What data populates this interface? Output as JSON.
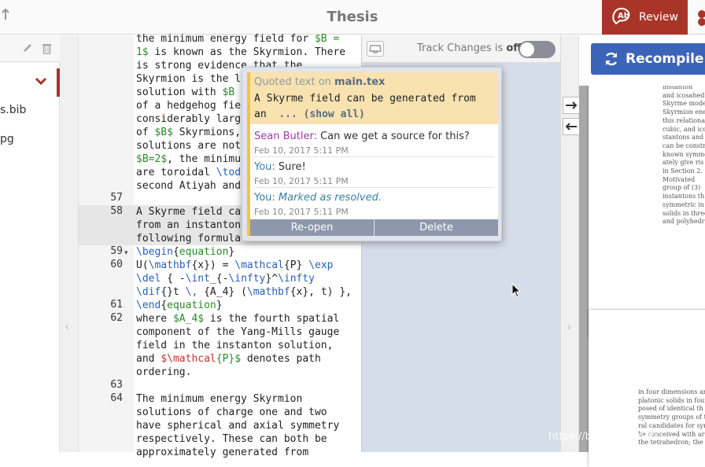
{
  "header": {
    "title": "Thesis",
    "review_label": "Review",
    "accent": "#a93529"
  },
  "filetree": {
    "files": [
      {
        "label": "s.bib"
      },
      {
        "label": "pg"
      }
    ]
  },
  "editor": {
    "line_numbers": [
      "57",
      "58",
      "59",
      "60",
      "61",
      "62",
      "63",
      "64"
    ],
    "lines": {
      "l1": "the minimum energy field for ",
      "l1a": "$B =",
      "l2a": "1$",
      "l2": " is known as the Skyrmion. There",
      "l3": "is strong evidence that the",
      "l4": "Skyrmion is the l",
      "l5": "solution with ",
      "l5a": "$B",
      "l6": "of a hedgehog fie",
      "l7": "considerably larg",
      "l8": "of ",
      "l8a": "$B$",
      "l8b": " Skyrmions,",
      "l9": "solutions are not",
      "l10a": "$B=2$",
      "l10": ", the minimu",
      "l11": "are toroidal ",
      "l11a": "\\tod",
      "l12": "second Atiyah and",
      "l58a": "A Skyrme field ca",
      "l58b": "from an instanton",
      "l58c": "following formula",
      "l59a": "\\begin",
      "l59b": "{",
      "l59c": "equation",
      "l59d": "}",
      "l60a": "U(",
      "l60b": "\\mathbf",
      "l60c": "{x}) = ",
      "l60d": "\\mathcal",
      "l60e": "{P} ",
      "l60f": "\\exp",
      "l60g": "\\del",
      "l60h": " { -",
      "l60i": "\\int",
      "l60j": "_{-",
      "l60k": "\\infty",
      "l60l": "}^",
      "l60m": "\\infty",
      "l60n": "\\dif",
      "l60o": "{}t ",
      "l60p": "\\,",
      "l60q": " {A_4} (",
      "l60r": "\\mathbf",
      "l60s": "{x}, t) },",
      "l61a": "\\end",
      "l61b": "{",
      "l61c": "equation",
      "l61d": "}",
      "l62a": "where ",
      "l62b": "$A_4$",
      "l62c": " is the fourth spatial",
      "l62d": "component of the Yang-Mills gauge",
      "l62e": "field in the instanton solution,",
      "l62f": "and ",
      "l62g": "$\\mathcal",
      "l62h": "{P}$",
      "l62i": " denotes path",
      "l62j": "ordering.",
      "l64a": "The minimum energy Skyrmion",
      "l64b": "solutions of charge one and two",
      "l64c": "have spherical and axial symmetry",
      "l64d": "respectively. These can both be",
      "l64e": "approximately generated from"
    }
  },
  "review_panel": {
    "track_changes_prefix": "Track Changes is ",
    "track_changes_state": "off",
    "toggle_on": false
  },
  "pdf": {
    "recompile_label": "Recompile",
    "page1_lines": [
      "instanton",
      "and icosahed",
      "Skyrme mode",
      "Skyrmion ene",
      "this relational",
      "cubic, and ico",
      "stantons and",
      "can be constr",
      "known symme",
      "ately give ris",
      "in Section 2.",
      "Motivated",
      "group of (3)",
      "instantons th",
      "symmetric in",
      "solids in three",
      "and polyhedr"
    ],
    "page2_lines": [
      "in four dimensions an",
      "platonic solids in four",
      "posed of identical th",
      "symmetry groups of th",
      "ral candidates for sym",
      "be conceived with ar",
      "the tetrahedron; the"
    ]
  },
  "popup": {
    "quote_prefix": "Quoted text on ",
    "quote_file": "main.tex",
    "quote_line1": "A Skyrme field can be generated from",
    "quote_line2": "an  ",
    "show_all": "... (show all)",
    "messages": [
      {
        "author": "Sean Butler:",
        "text": " Can we get a source for this?",
        "date": "Feb 10, 2017 5:11 PM",
        "color": "#9b3ba8"
      },
      {
        "author": "You:",
        "text": "  Sure!",
        "date": "Feb 10, 2017 5:11 PM",
        "color": "#3a7fa5"
      },
      {
        "author": "You:",
        "text": " Marked as resolved.",
        "date": "Feb 10, 2017 5:11 PM",
        "color": "#3a7fa5"
      }
    ],
    "reopen_label": "Re-open",
    "delete_label": "Delete"
  },
  "watermark": "https://blog.csdn.net/..."
}
